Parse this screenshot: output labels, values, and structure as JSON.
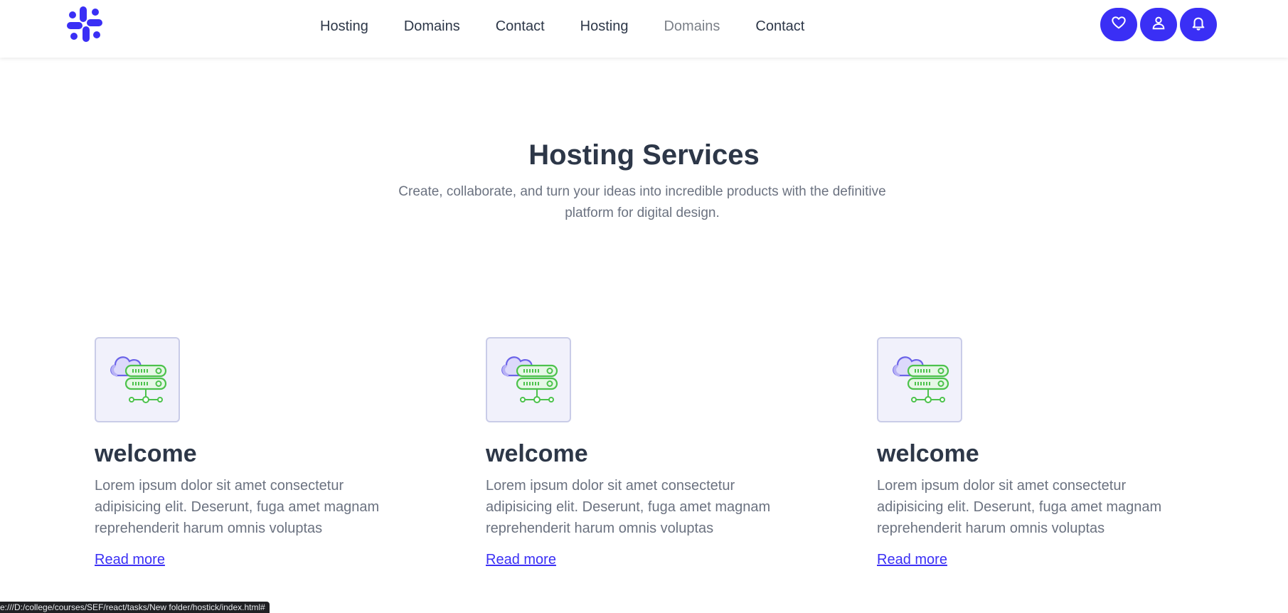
{
  "nav": {
    "links": [
      "Hosting",
      "Domains",
      "Contact",
      "Hosting",
      "Domains",
      "Contact"
    ]
  },
  "hero": {
    "title": "Hosting Services",
    "subtitle": "Create, collaborate, and turn your ideas into incredible products with the definitive platform for digital design."
  },
  "cards": [
    {
      "title": "welcome",
      "text": "Lorem ipsum dolor sit amet consectetur adipisicing elit. Deserunt, fuga amet magnam reprehenderit harum omnis voluptas",
      "link": "Read more"
    },
    {
      "title": "welcome",
      "text": "Lorem ipsum dolor sit amet consectetur adipisicing elit. Deserunt, fuga amet magnam reprehenderit harum omnis voluptas",
      "link": "Read more"
    },
    {
      "title": "welcome",
      "text": "Lorem ipsum dolor sit amet consectetur adipisicing elit. Deserunt, fuga amet magnam reprehenderit harum omnis voluptas",
      "link": "Read more"
    }
  ],
  "icons": {
    "logo": "slack-style-logo",
    "heart": "heart-icon",
    "user": "user-icon",
    "bell": "bell-icon",
    "card": "cloud-server-icon"
  },
  "colors": {
    "accent": "#3a2ff5",
    "heading": "#2d3748",
    "muted": "#6b7280",
    "server_green": "#4cc24c",
    "cloud_purple": "#6b63e8"
  },
  "status_bar": {
    "url": "e:///D:/college/courses/SEF/react/tasks/New folder/hostick/index.html#"
  }
}
